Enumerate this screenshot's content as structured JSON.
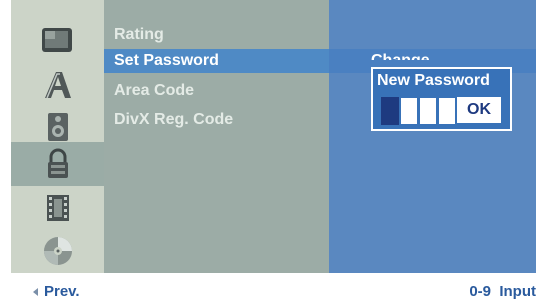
{
  "menu": {
    "items": [
      {
        "label": "Rating"
      },
      {
        "label": "Set Password"
      },
      {
        "label": "Area Code"
      },
      {
        "label": "DivX Reg. Code"
      }
    ]
  },
  "icons": [
    {
      "name": "tv-icon"
    },
    {
      "name": "language-icon"
    },
    {
      "name": "speaker-icon"
    },
    {
      "name": "lock-icon"
    },
    {
      "name": "film-icon"
    },
    {
      "name": "disc-icon"
    }
  ],
  "right": {
    "change_label": "Change"
  },
  "popup": {
    "title": "New Password",
    "ok_label": "OK",
    "digits_entered": 1,
    "digits_total": 4
  },
  "footer": {
    "prev_label": "Prev.",
    "input_hint": "0-9  Input"
  }
}
